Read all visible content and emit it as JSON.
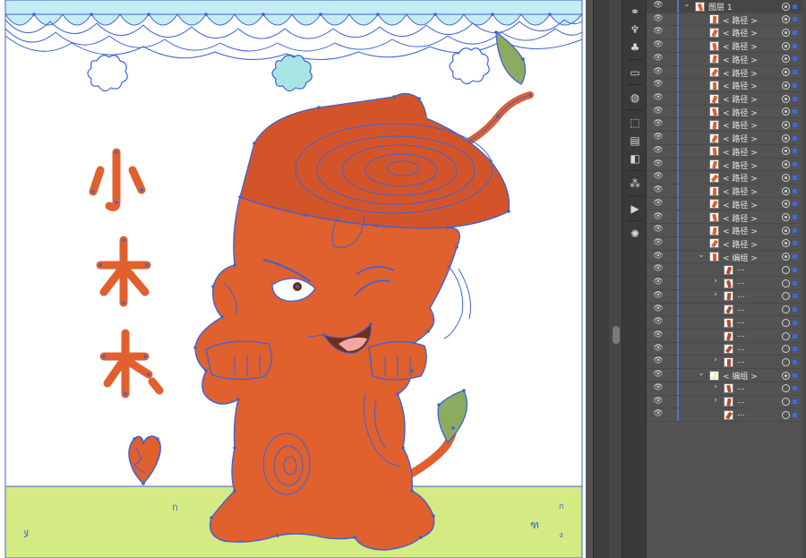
{
  "layers_panel": {
    "top_layer": {
      "label": "图层 1",
      "color": "#4b73d8"
    },
    "paths": [
      {
        "label": "< 路径 >"
      },
      {
        "label": "< 路径 >"
      },
      {
        "label": "< 路径 >"
      },
      {
        "label": "< 路径 >"
      },
      {
        "label": "< 路径 >"
      },
      {
        "label": "< 路径 >"
      },
      {
        "label": "< 路径 >"
      },
      {
        "label": "< 路径 >"
      },
      {
        "label": "< 路径 >"
      },
      {
        "label": "< 路径 >"
      },
      {
        "label": "< 路径 >"
      },
      {
        "label": "< 路径 >"
      },
      {
        "label": "< 路径 >"
      },
      {
        "label": "< 路径 >"
      },
      {
        "label": "< 路径 >"
      },
      {
        "label": "< 路径 >"
      },
      {
        "label": "< 路径 >"
      },
      {
        "label": "< 路径 >"
      }
    ],
    "group1": {
      "label": "< 编组 >",
      "children": [
        {
          "label": "..."
        },
        {
          "label": "..."
        },
        {
          "label": "..."
        },
        {
          "label": "..."
        },
        {
          "label": "..."
        },
        {
          "label": "..."
        },
        {
          "label": "..."
        },
        {
          "label": "..."
        }
      ]
    },
    "group2": {
      "label": "< 编组 >",
      "children": [
        {
          "label": "..."
        },
        {
          "label": "..."
        },
        {
          "label": "..."
        }
      ]
    }
  },
  "canvas": {
    "vertical_text": [
      "小",
      "木",
      "木"
    ],
    "colors": {
      "sky": "#c4ecf3",
      "ground": "#d4ea83",
      "tree_body": "#e0602e",
      "tree_top": "#d4542a",
      "anchor_blue": "#3b63d6",
      "leaf": "#8cab5e",
      "cloud": "#a8e6e4"
    }
  },
  "tools": [
    "link-icon",
    "puppet-warp-icon",
    "club-symbol-icon",
    "rectangle-icon",
    "globe-icon",
    "align-icon",
    "distribute-icon",
    "pathfinder-icon",
    "magic-wand-icon",
    "play-icon",
    "sun-icon"
  ]
}
